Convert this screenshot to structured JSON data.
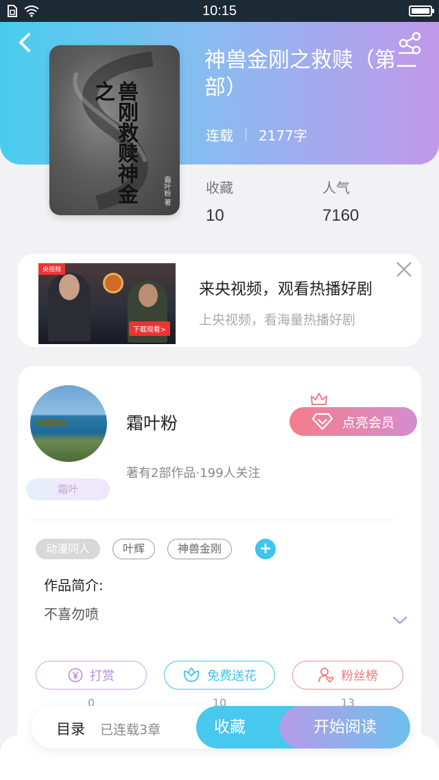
{
  "status_bar": {
    "time": "10:15"
  },
  "book": {
    "title": "神兽金刚之救赎（第二部）",
    "status": "连载",
    "word_count": "2177字",
    "cover_title": "兽刚救赎神金之",
    "cover_author": "霜叶粉 著",
    "stats": [
      {
        "label": "收藏",
        "value": "10"
      },
      {
        "label": "人气",
        "value": "7160"
      }
    ]
  },
  "ad": {
    "title": "来央视频，观看热播好剧",
    "subtitle": "上央视频，看海量热播好剧",
    "thumb_brand": "央视频",
    "thumb_button": "下载观看>"
  },
  "author": {
    "name": "霜叶粉",
    "stats_text": "著有2部作品·199人关注",
    "badge": "霜叶",
    "vip_button": "点亮会员"
  },
  "tags": [
    "动漫同人",
    "叶辉",
    "神兽金刚"
  ],
  "intro": {
    "label": "作品简介:",
    "text": "不喜勿喷"
  },
  "actions": [
    {
      "label": "打赏",
      "count": "0",
      "color": "#b98be0"
    },
    {
      "label": "免费送花",
      "count": "10",
      "color": "#3ec4ef"
    },
    {
      "label": "粉丝榜",
      "count": "13",
      "color": "#ef7a7a"
    }
  ],
  "bottom_bar": {
    "toc": "目录",
    "chapters": "已连载3章",
    "favorite": "收藏",
    "read": "开始阅读"
  }
}
